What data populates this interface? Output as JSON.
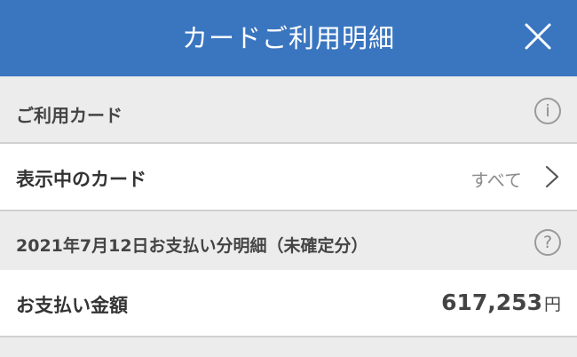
{
  "header": {
    "title": "カードご利用明細",
    "close_icon": "close-icon",
    "bg_color": "#3a76c0"
  },
  "usage_card_section": {
    "title": "ご利用カード",
    "icon": "i",
    "icon_name": "info-icon"
  },
  "card_row": {
    "label": "表示中のカード",
    "value": "すべて",
    "icon_name": "chevron-right-icon"
  },
  "statement_section": {
    "title": "2021年7月12日お支払い分明細（未確定分）",
    "icon": "?",
    "icon_name": "help-icon"
  },
  "payment_row": {
    "label": "お支払い金額",
    "amount": "617,253",
    "unit": "円"
  }
}
